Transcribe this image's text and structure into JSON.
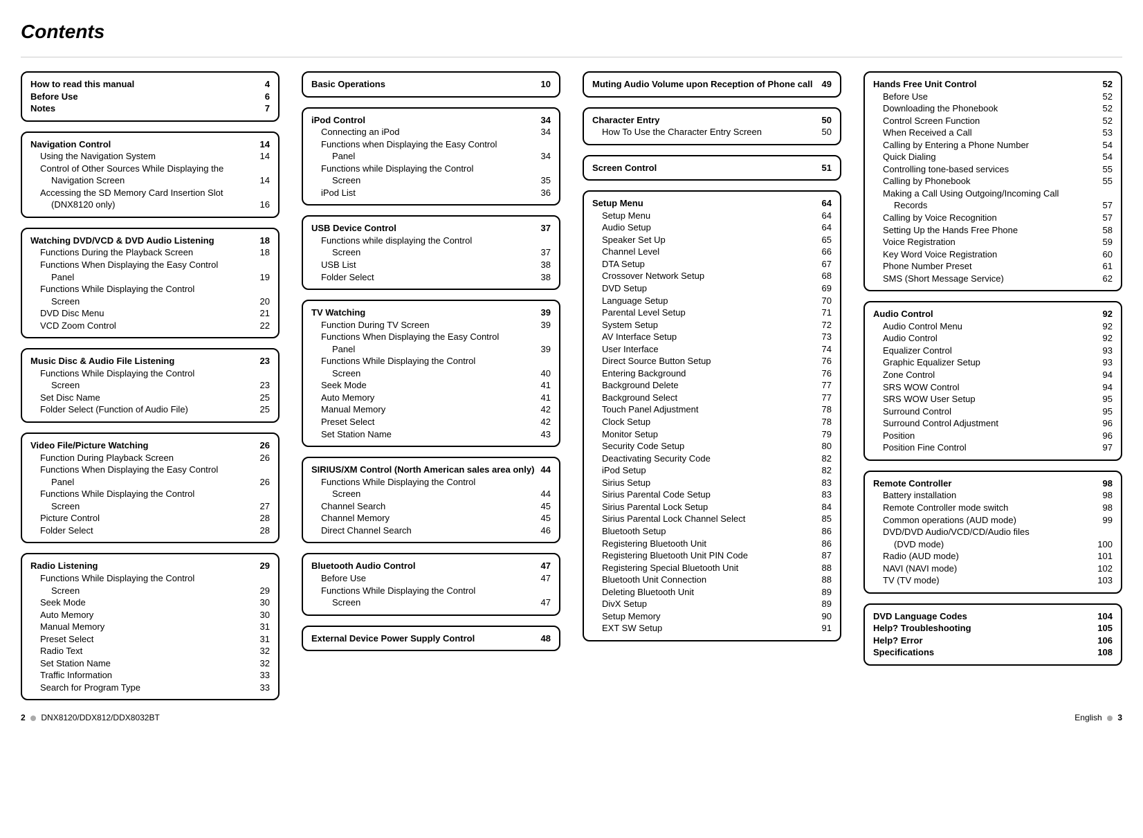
{
  "heading": "Contents",
  "footer": {
    "left_page": "2",
    "model": "DNX8120/DDX812/DDX8032BT",
    "lang": "English",
    "right_page": "3"
  },
  "columns": [
    [
      {
        "titles": [
          {
            "label": "How to read this manual",
            "page": "4"
          },
          {
            "label": "Before Use",
            "page": "6"
          },
          {
            "label": "Notes",
            "page": "7"
          }
        ],
        "items": []
      },
      {
        "titles": [
          {
            "label": "Navigation Control",
            "page": "14"
          }
        ],
        "items": [
          {
            "label": "Using the Navigation System",
            "page": "14"
          },
          {
            "label": "Control of Other Sources While Displaying the",
            "page": ""
          },
          {
            "label": "Navigation Screen",
            "page": "14",
            "cont": true
          },
          {
            "label": "Accessing the SD Memory Card Insertion Slot",
            "page": ""
          },
          {
            "label": "(DNX8120 only)",
            "page": "16",
            "cont": true
          }
        ]
      },
      {
        "titles": [
          {
            "label": "Watching DVD/VCD & DVD Audio Listening",
            "page": "18"
          }
        ],
        "items": [
          {
            "label": "Functions During the Playback Screen",
            "page": "18"
          },
          {
            "label": "Functions When Displaying the Easy Control",
            "page": ""
          },
          {
            "label": "Panel",
            "page": "19",
            "cont": true
          },
          {
            "label": "Functions While Displaying the Control",
            "page": ""
          },
          {
            "label": "Screen",
            "page": "20",
            "cont": true
          },
          {
            "label": "DVD Disc Menu",
            "page": "21"
          },
          {
            "label": "VCD Zoom Control",
            "page": "22"
          }
        ]
      },
      {
        "titles": [
          {
            "label": "Music Disc & Audio File Listening",
            "page": "23"
          }
        ],
        "items": [
          {
            "label": "Functions While Displaying the Control",
            "page": ""
          },
          {
            "label": "Screen",
            "page": "23",
            "cont": true
          },
          {
            "label": "Set Disc Name",
            "page": "25"
          },
          {
            "label": "Folder Select (Function of Audio File)",
            "page": "25"
          }
        ]
      },
      {
        "titles": [
          {
            "label": "Video File/Picture Watching",
            "page": "26"
          }
        ],
        "items": [
          {
            "label": "Function During Playback Screen",
            "page": "26"
          },
          {
            "label": "Functions When Displaying the Easy Control",
            "page": ""
          },
          {
            "label": "Panel",
            "page": "26",
            "cont": true
          },
          {
            "label": "Functions While Displaying the Control",
            "page": ""
          },
          {
            "label": "Screen",
            "page": "27",
            "cont": true
          },
          {
            "label": "Picture Control",
            "page": "28"
          },
          {
            "label": "Folder Select",
            "page": "28"
          }
        ]
      },
      {
        "titles": [
          {
            "label": "Radio Listening",
            "page": "29"
          }
        ],
        "items": [
          {
            "label": "Functions While Displaying the Control",
            "page": ""
          },
          {
            "label": "Screen",
            "page": "29",
            "cont": true
          },
          {
            "label": "Seek Mode",
            "page": "30"
          },
          {
            "label": "Auto Memory",
            "page": "30"
          },
          {
            "label": "Manual Memory",
            "page": "31"
          },
          {
            "label": "Preset Select",
            "page": "31"
          },
          {
            "label": "Radio Text",
            "page": "32"
          },
          {
            "label": "Set Station Name",
            "page": "32"
          },
          {
            "label": "Traffic Information",
            "page": "33"
          },
          {
            "label": "Search for Program Type",
            "page": "33"
          }
        ]
      }
    ],
    [
      {
        "titles": [
          {
            "label": "Basic Operations",
            "page": "10"
          }
        ],
        "items": []
      },
      {
        "titles": [
          {
            "label": "iPod Control",
            "page": "34"
          }
        ],
        "items": [
          {
            "label": "Connecting an iPod",
            "page": "34"
          },
          {
            "label": "Functions when Displaying the Easy Control",
            "page": ""
          },
          {
            "label": "Panel",
            "page": "34",
            "cont": true
          },
          {
            "label": "Functions while Displaying the Control",
            "page": ""
          },
          {
            "label": "Screen",
            "page": "35",
            "cont": true
          },
          {
            "label": "iPod List",
            "page": "36"
          }
        ]
      },
      {
        "titles": [
          {
            "label": "USB Device Control",
            "page": "37"
          }
        ],
        "items": [
          {
            "label": "Functions while displaying the Control",
            "page": ""
          },
          {
            "label": "Screen",
            "page": "37",
            "cont": true
          },
          {
            "label": "USB List",
            "page": "38"
          },
          {
            "label": "Folder Select",
            "page": "38"
          }
        ]
      },
      {
        "titles": [
          {
            "label": "TV Watching",
            "page": "39"
          }
        ],
        "items": [
          {
            "label": "Function During TV Screen",
            "page": "39"
          },
          {
            "label": "Functions When Displaying the Easy Control",
            "page": ""
          },
          {
            "label": "Panel",
            "page": "39",
            "cont": true
          },
          {
            "label": "Functions While Displaying the Control",
            "page": ""
          },
          {
            "label": "Screen",
            "page": "40",
            "cont": true
          },
          {
            "label": "Seek Mode",
            "page": "41"
          },
          {
            "label": "Auto Memory",
            "page": "41"
          },
          {
            "label": "Manual Memory",
            "page": "42"
          },
          {
            "label": "Preset Select",
            "page": "42"
          },
          {
            "label": "Set Station Name",
            "page": "43"
          }
        ]
      },
      {
        "titles": [
          {
            "label": "SIRIUS/XM Control (North American sales area only)",
            "page": "44"
          }
        ],
        "items": [
          {
            "label": "Functions While Displaying the Control",
            "page": ""
          },
          {
            "label": "Screen",
            "page": "44",
            "cont": true
          },
          {
            "label": "Channel Search",
            "page": "45"
          },
          {
            "label": "Channel Memory",
            "page": "45"
          },
          {
            "label": "Direct Channel Search",
            "page": "46"
          }
        ]
      },
      {
        "titles": [
          {
            "label": "Bluetooth Audio Control",
            "page": "47"
          }
        ],
        "items": [
          {
            "label": "Before Use",
            "page": "47"
          },
          {
            "label": "Functions While Displaying the Control",
            "page": ""
          },
          {
            "label": "Screen",
            "page": "47",
            "cont": true
          }
        ]
      },
      {
        "titles": [
          {
            "label": "External Device Power Supply Control",
            "page": "48"
          }
        ],
        "items": []
      }
    ],
    [
      {
        "titles": [
          {
            "label": "Muting Audio Volume upon Reception of Phone call",
            "page": "49"
          }
        ],
        "items": []
      },
      {
        "titles": [
          {
            "label": "Character Entry",
            "page": "50"
          }
        ],
        "items": [
          {
            "label": "How To Use the Character Entry Screen",
            "page": "50"
          }
        ]
      },
      {
        "titles": [
          {
            "label": "Screen Control",
            "page": "51"
          }
        ],
        "items": []
      },
      {
        "titles": [
          {
            "label": "Setup Menu",
            "page": "64"
          }
        ],
        "items": [
          {
            "label": "Setup Menu",
            "page": "64"
          },
          {
            "label": "Audio Setup",
            "page": "64"
          },
          {
            "label": "Speaker Set Up",
            "page": "65"
          },
          {
            "label": "Channel Level",
            "page": "66"
          },
          {
            "label": "DTA Setup",
            "page": "67"
          },
          {
            "label": "Crossover Network Setup",
            "page": "68"
          },
          {
            "label": "DVD Setup",
            "page": "69"
          },
          {
            "label": "Language Setup",
            "page": "70"
          },
          {
            "label": "Parental Level Setup",
            "page": "71"
          },
          {
            "label": "System Setup",
            "page": "72"
          },
          {
            "label": "AV Interface Setup",
            "page": "73"
          },
          {
            "label": "User Interface",
            "page": "74"
          },
          {
            "label": "Direct Source Button Setup",
            "page": "76"
          },
          {
            "label": "Entering Background",
            "page": "76"
          },
          {
            "label": "Background Delete",
            "page": "77"
          },
          {
            "label": "Background Select",
            "page": "77"
          },
          {
            "label": "Touch Panel Adjustment",
            "page": "78"
          },
          {
            "label": "Clock Setup",
            "page": "78"
          },
          {
            "label": "Monitor Setup",
            "page": "79"
          },
          {
            "label": "Security Code Setup",
            "page": "80"
          },
          {
            "label": "Deactivating Security Code",
            "page": "82"
          },
          {
            "label": "iPod Setup",
            "page": "82"
          },
          {
            "label": "Sirius Setup",
            "page": "83"
          },
          {
            "label": "Sirius Parental Code Setup",
            "page": "83"
          },
          {
            "label": "Sirius Parental Lock Setup",
            "page": "84"
          },
          {
            "label": "Sirius Parental Lock Channel Select",
            "page": "85"
          },
          {
            "label": "Bluetooth Setup",
            "page": "86"
          },
          {
            "label": "Registering Bluetooth Unit",
            "page": "86"
          },
          {
            "label": "Registering Bluetooth Unit PIN Code",
            "page": "87"
          },
          {
            "label": "Registering Special Bluetooth Unit",
            "page": "88"
          },
          {
            "label": "Bluetooth Unit Connection",
            "page": "88"
          },
          {
            "label": "Deleting Bluetooth Unit",
            "page": "89"
          },
          {
            "label": "DivX Setup",
            "page": "89"
          },
          {
            "label": "Setup Memory",
            "page": "90"
          },
          {
            "label": "EXT SW Setup",
            "page": "91"
          }
        ]
      }
    ],
    [
      {
        "titles": [
          {
            "label": "Hands Free Unit Control",
            "page": "52"
          }
        ],
        "items": [
          {
            "label": "Before Use",
            "page": "52"
          },
          {
            "label": "Downloading the Phonebook",
            "page": "52"
          },
          {
            "label": "Control Screen Function",
            "page": "52"
          },
          {
            "label": "When Received a Call",
            "page": "53"
          },
          {
            "label": "Calling by Entering a Phone Number",
            "page": "54"
          },
          {
            "label": "Quick Dialing",
            "page": "54"
          },
          {
            "label": "Controlling tone-based services",
            "page": "55"
          },
          {
            "label": "Calling by Phonebook",
            "page": "55"
          },
          {
            "label": "Making a Call Using Outgoing/Incoming Call",
            "page": ""
          },
          {
            "label": "Records",
            "page": "57",
            "cont": true
          },
          {
            "label": "Calling by Voice Recognition",
            "page": "57"
          },
          {
            "label": "Setting Up the Hands Free Phone",
            "page": "58"
          },
          {
            "label": "Voice Registration",
            "page": "59"
          },
          {
            "label": "Key Word Voice Registration",
            "page": "60"
          },
          {
            "label": "Phone Number Preset",
            "page": "61"
          },
          {
            "label": "SMS (Short Message Service)",
            "page": "62"
          }
        ]
      },
      {
        "titles": [
          {
            "label": "Audio Control",
            "page": "92"
          }
        ],
        "items": [
          {
            "label": "Audio Control Menu",
            "page": "92"
          },
          {
            "label": "Audio Control",
            "page": "92"
          },
          {
            "label": "Equalizer Control",
            "page": "93"
          },
          {
            "label": "Graphic Equalizer Setup",
            "page": "93"
          },
          {
            "label": "Zone Control",
            "page": "94"
          },
          {
            "label": "SRS WOW Control",
            "page": "94"
          },
          {
            "label": "SRS WOW User Setup",
            "page": "95"
          },
          {
            "label": "Surround Control",
            "page": "95"
          },
          {
            "label": "Surround Control Adjustment",
            "page": "96"
          },
          {
            "label": "Position",
            "page": "96"
          },
          {
            "label": "Position Fine Control",
            "page": "97"
          }
        ]
      },
      {
        "titles": [
          {
            "label": "Remote Controller",
            "page": "98"
          }
        ],
        "items": [
          {
            "label": "Battery installation",
            "page": "98"
          },
          {
            "label": "Remote Controller mode switch",
            "page": "98"
          },
          {
            "label": "Common operations (AUD mode)",
            "page": "99"
          },
          {
            "label": "DVD/DVD Audio/VCD/CD/Audio files",
            "page": ""
          },
          {
            "label": "(DVD mode)",
            "page": "100",
            "cont": true
          },
          {
            "label": "Radio (AUD mode)",
            "page": "101"
          },
          {
            "label": "NAVI (NAVI mode)",
            "page": "102"
          },
          {
            "label": "TV (TV mode)",
            "page": "103"
          }
        ]
      },
      {
        "titles": [
          {
            "label": "DVD Language Codes",
            "page": "104"
          },
          {
            "label": "Help? Troubleshooting",
            "page": "105"
          },
          {
            "label": "Help? Error",
            "page": "106"
          },
          {
            "label": "Specifications",
            "page": "108"
          }
        ],
        "items": []
      }
    ]
  ]
}
